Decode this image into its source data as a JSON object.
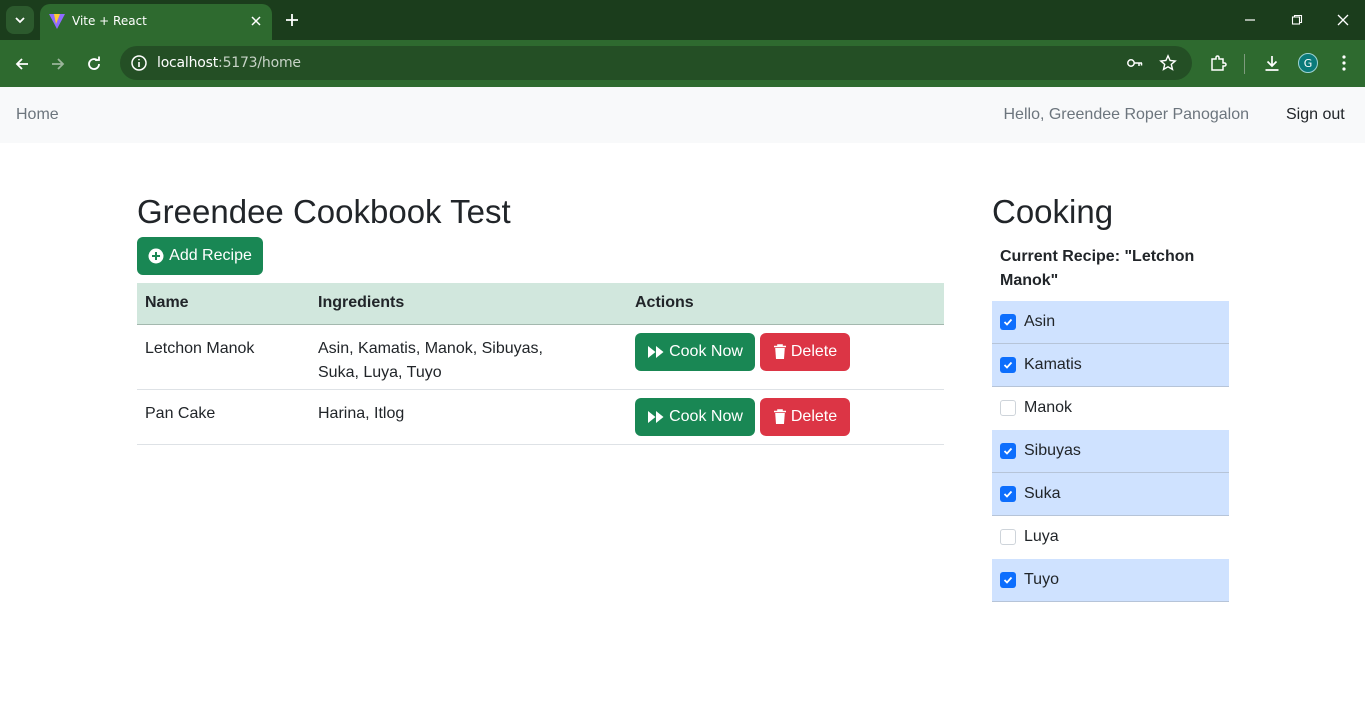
{
  "browser": {
    "tab_title": "Vite + React",
    "url_host": "localhost",
    "url_rest": ":5173/home",
    "profile_initial": "G",
    "accent": "#2e6a2f"
  },
  "navbar": {
    "home": "Home",
    "greeting": "Hello, Greendee Roper Panogalon",
    "sign_out": "Sign out"
  },
  "main": {
    "title": "Greendee Cookbook Test",
    "add_recipe": "Add Recipe",
    "table": {
      "headers": [
        "Name",
        "Ingredients",
        "Actions"
      ],
      "rows": [
        {
          "name": "Letchon Manok",
          "ingredients": "Asin, Kamatis, Manok, Sibuyas, Suka, Luya, Tuyo"
        },
        {
          "name": "Pan Cake",
          "ingredients": "Harina, Itlog"
        }
      ],
      "cook_label": "Cook Now",
      "delete_label": "Delete"
    }
  },
  "cooking": {
    "title": "Cooking",
    "current_recipe": "Current Recipe: \"Letchon Manok\"",
    "ingredients": [
      {
        "label": "Asin",
        "checked": true
      },
      {
        "label": "Kamatis",
        "checked": true
      },
      {
        "label": "Manok",
        "checked": false
      },
      {
        "label": "Sibuyas",
        "checked": true
      },
      {
        "label": "Suka",
        "checked": true
      },
      {
        "label": "Luya",
        "checked": false
      },
      {
        "label": "Tuyo",
        "checked": true
      }
    ]
  },
  "colors": {
    "success": "#198754",
    "danger": "#dc3545",
    "table_header": "#d1e7dd",
    "checked_row": "#cfe2ff",
    "checkbox": "#0d6efd"
  }
}
